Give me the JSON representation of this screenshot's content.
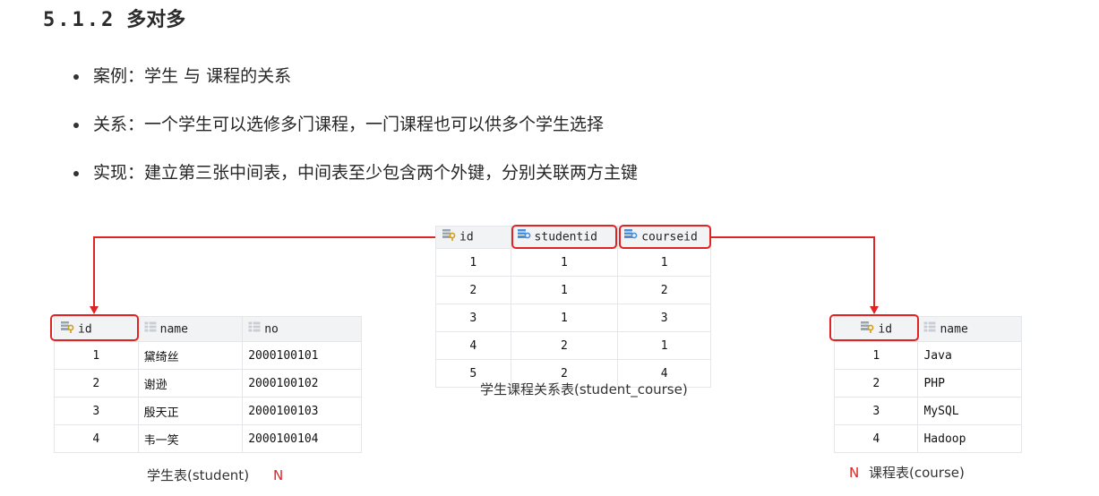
{
  "heading": {
    "number": "5.1.2",
    "text": "多对多"
  },
  "bullets": [
    "案例：学生  与  课程的关系",
    "关系：一个学生可以选修多门课程，一门课程也可以供多个学生选择",
    "实现：建立第三张中间表，中间表至少包含两个外键，分别关联两方主键"
  ],
  "student_table": {
    "columns": [
      "id",
      "name",
      "no"
    ],
    "rows": [
      [
        "1",
        "黛绮丝",
        "2000100101"
      ],
      [
        "2",
        "谢逊",
        "2000100102"
      ],
      [
        "3",
        "殷天正",
        "2000100103"
      ],
      [
        "4",
        "韦一笑",
        "2000100104"
      ]
    ],
    "caption": "学生表(student)",
    "mark": "N"
  },
  "student_course_table": {
    "columns": [
      "id",
      "studentid",
      "courseid"
    ],
    "rows": [
      [
        "1",
        "1",
        "1"
      ],
      [
        "2",
        "1",
        "2"
      ],
      [
        "3",
        "1",
        "3"
      ],
      [
        "4",
        "2",
        "1"
      ],
      [
        "5",
        "2",
        "4"
      ]
    ],
    "caption": "学生课程关系表(student_course)"
  },
  "course_table": {
    "columns": [
      "id",
      "name"
    ],
    "rows": [
      [
        "1",
        "Java"
      ],
      [
        "2",
        "PHP"
      ],
      [
        "3",
        "MySQL"
      ],
      [
        "4",
        "Hadoop"
      ]
    ],
    "caption": "课程表(course)",
    "mark": "N"
  },
  "colors": {
    "highlight": "#e02424",
    "header_bg": "#f2f3f5"
  },
  "icons": {
    "primary_key": "key-column-icon",
    "foreign_key": "fk-column-icon",
    "column": "column-icon"
  }
}
